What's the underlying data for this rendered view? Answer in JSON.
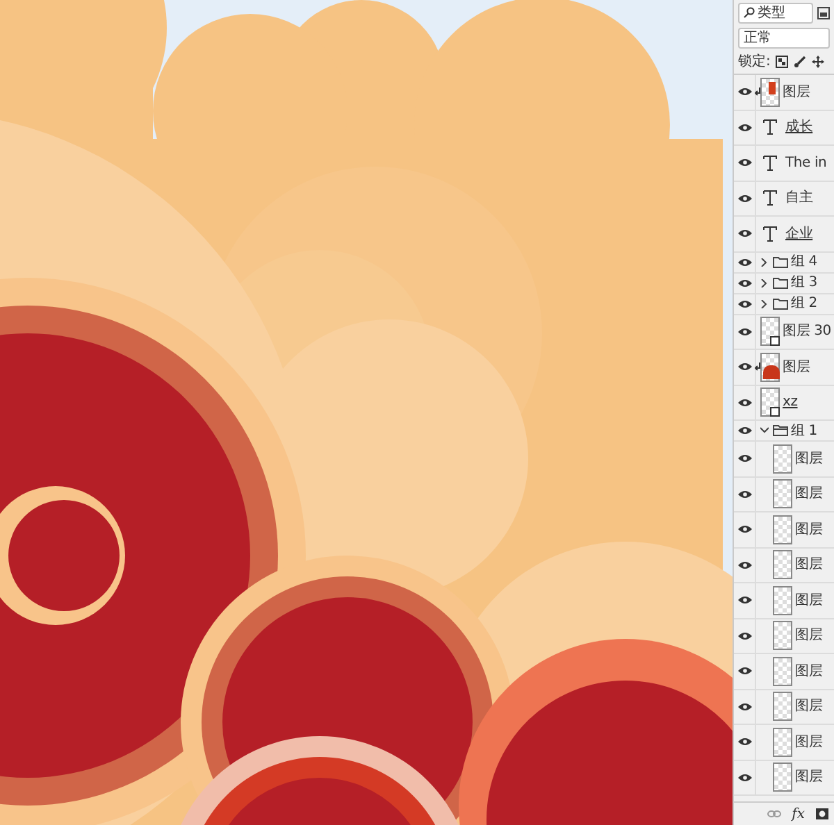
{
  "layers_panel": {
    "filter": {
      "value": "类型"
    },
    "blend_mode": {
      "value": "正常"
    },
    "lock_label": "锁定:",
    "layers": [
      {
        "kind": "figure_layer",
        "name": "图层",
        "visible": true,
        "clipped": true
      },
      {
        "kind": "text",
        "name": "成长",
        "visible": true,
        "underlined": true
      },
      {
        "kind": "text",
        "name": "The in",
        "visible": true
      },
      {
        "kind": "text",
        "name": "自主",
        "visible": true
      },
      {
        "kind": "text",
        "name": "企业",
        "visible": true,
        "underlined": true
      },
      {
        "kind": "group",
        "name": "组 4",
        "visible": true,
        "expanded": false
      },
      {
        "kind": "group",
        "name": "组 3",
        "visible": true,
        "expanded": false
      },
      {
        "kind": "group",
        "name": "组 2",
        "visible": true,
        "expanded": false
      },
      {
        "kind": "smart",
        "name": "图层 30",
        "visible": true
      },
      {
        "kind": "red_layer",
        "name": "图层",
        "visible": true,
        "clipped": true
      },
      {
        "kind": "smart",
        "name": "xz",
        "visible": true,
        "underlined": true
      },
      {
        "kind": "group",
        "name": "组 1",
        "visible": true,
        "expanded": true,
        "children": [
          {
            "kind": "layer",
            "name": "图层",
            "visible": true
          },
          {
            "kind": "layer",
            "name": "图层",
            "visible": true
          },
          {
            "kind": "layer",
            "name": "图层",
            "visible": true
          },
          {
            "kind": "layer",
            "name": "图层",
            "visible": true
          },
          {
            "kind": "layer",
            "name": "图层",
            "visible": true
          },
          {
            "kind": "layer",
            "name": "图层",
            "visible": true
          },
          {
            "kind": "layer",
            "name": "图层",
            "visible": true
          },
          {
            "kind": "layer",
            "name": "图层",
            "visible": true
          },
          {
            "kind": "layer",
            "name": "图层",
            "visible": true
          },
          {
            "kind": "layer",
            "name": "图层",
            "visible": true
          }
        ]
      }
    ],
    "footer": {
      "fx_label": "fx"
    }
  }
}
